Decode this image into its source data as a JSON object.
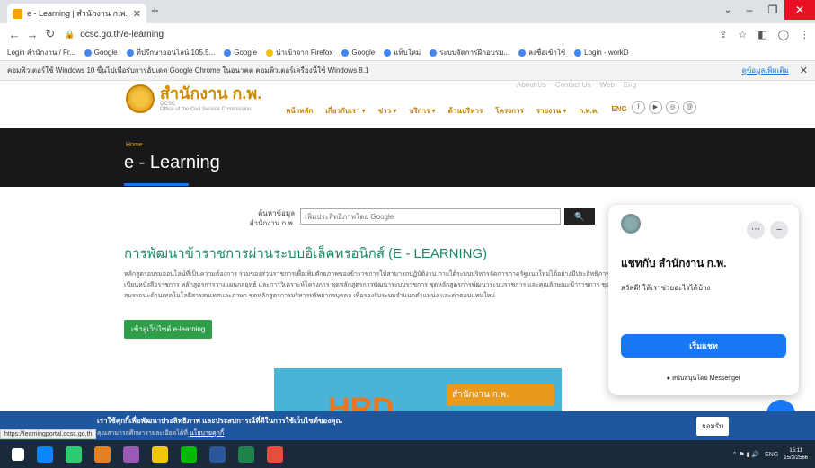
{
  "browser": {
    "tab_title": "e - Learning | สำนักงาน ก.พ. (OCSC",
    "url": "ocsc.go.th/e-learning",
    "bookmarks": [
      "Login สำนักงาน / Fr...",
      "Google",
      "ที่ปรึกษาออนไลน์ 105.5...",
      "Google",
      "นำเข้าจาก Firefox",
      "Google",
      "แท็บใหม่",
      "ระบบจัดการฝึกอบรม...",
      "ลงชื่อเข้าใช้",
      "Login - workD"
    ],
    "infobar_message": "คอมพิวเตอร์ใช้ Windows 10 ขึ้นไปเพื่อรับการอัปเดต Google Chrome ในอนาคต คอมพิวเตอร์เครื่องนี้ใช้ Windows 8.1",
    "infobar_more": "ดูข้อมูลเพิ่มเติม"
  },
  "site": {
    "logo_thai": "สำนักงาน ก.พ.",
    "logo_abbr": "OCSC",
    "logo_eng": "Office of the Civil Service Commission",
    "top_links": [
      "About Us",
      "Contact Us",
      "Web",
      "Eng"
    ],
    "nav": [
      "หน้าหลัก",
      "เกี่ยวกับเรา ▾",
      "ข่าว ▾",
      "บริการ ▾",
      "ด้านบริหาร",
      "โครงการ",
      "รายงาน ▾",
      "ก.พ.ค.",
      "ENG"
    ],
    "social": [
      "f",
      "▶",
      "◎",
      "@"
    ],
    "breadcrumb": "Home",
    "banner_title": "e - Learning",
    "search_label": "ค้นหาข้อมูล สำนักงาน ก.พ.",
    "search_placeholder": "เพิ่มประสิทธิภาพโดย Google",
    "search_button": "🔍",
    "heading": "การพัฒนาข้าราชการผ่านระบบอิเล็คทรอนิกส์ (E - LEARNING)",
    "desc_lines": [
      "หลักสูตรอบรมออนไลน์ที่เป็นความต้องการ ร่วมของส่วนราชการเพื่อเพิ่มศักยภาพของข้าราชการให้สามารถปฏิบัติงาน ภายใต้ระบบบริหารจัดการภาครัฐแนวใหม่ได้อย่างมีประสิทธิภาพ",
      "เขียนหนังสือราชการ หลักสูตรการวางแผนกลยุทธ์ และการวิเคราะห์โครงการ ชุดหลักสูตรการพัฒนาระบบราชการ ชุดหลักสูตรการพัฒนาระบบราชการ และคุณลักษณะข้าราชการ ชุดหลักสูตรการเสริมสร้างบรรยากาศ",
      "สมรรถนะด้านเทคโนโลยีสารสนเทศและภาษา ชุดหลักสูตรการบริหารทรัพยากรบุคคล เพื่อรองรับระบบจำแนกตำแหน่ง และค่าตอบแทนใหม่"
    ],
    "cta": "เข้าสู่เว็บไซต์ e-learning",
    "promo_logo": "สำนักงาน ก.พ.",
    "promo_letters": "HRD"
  },
  "chat": {
    "title": "แชทกับ สำนักงาน ก.พ.",
    "greeting": "สวัสดี! ให้เราช่วยอะไรได้บ้าง",
    "start_button": "เริ่มแชท",
    "powered": "สนับสนุนโดย Messenger"
  },
  "cookie": {
    "text": "เราใช้คุกกี้เพื่อพัฒนาประสิทธิภาพ และประสบการณ์ที่ดีในการใช้เว็บไซต์ของคุณ",
    "sub": "คุณสามารถศึกษารายละเอียดได้ที่",
    "link": "นโยบายคุกกี้",
    "accept": "ยอมรับ"
  },
  "status_url": "https://learningportal.ocsc.go.th",
  "taskbar": {
    "lang": "ENG",
    "time": "15:11",
    "date": "15/3/2566",
    "icon_colors": [
      "#0a84ff",
      "#2ecc71",
      "#e67e22",
      "#9b59b6",
      "#f1c40f",
      "#00b900",
      "#2b579a",
      "#1e8449",
      "#e74c3c"
    ]
  },
  "colors": {
    "accent": "#d08b00",
    "heading": "#1a8a6a",
    "messenger": "#1877f2",
    "cookie_bar": "#1e56a0"
  }
}
